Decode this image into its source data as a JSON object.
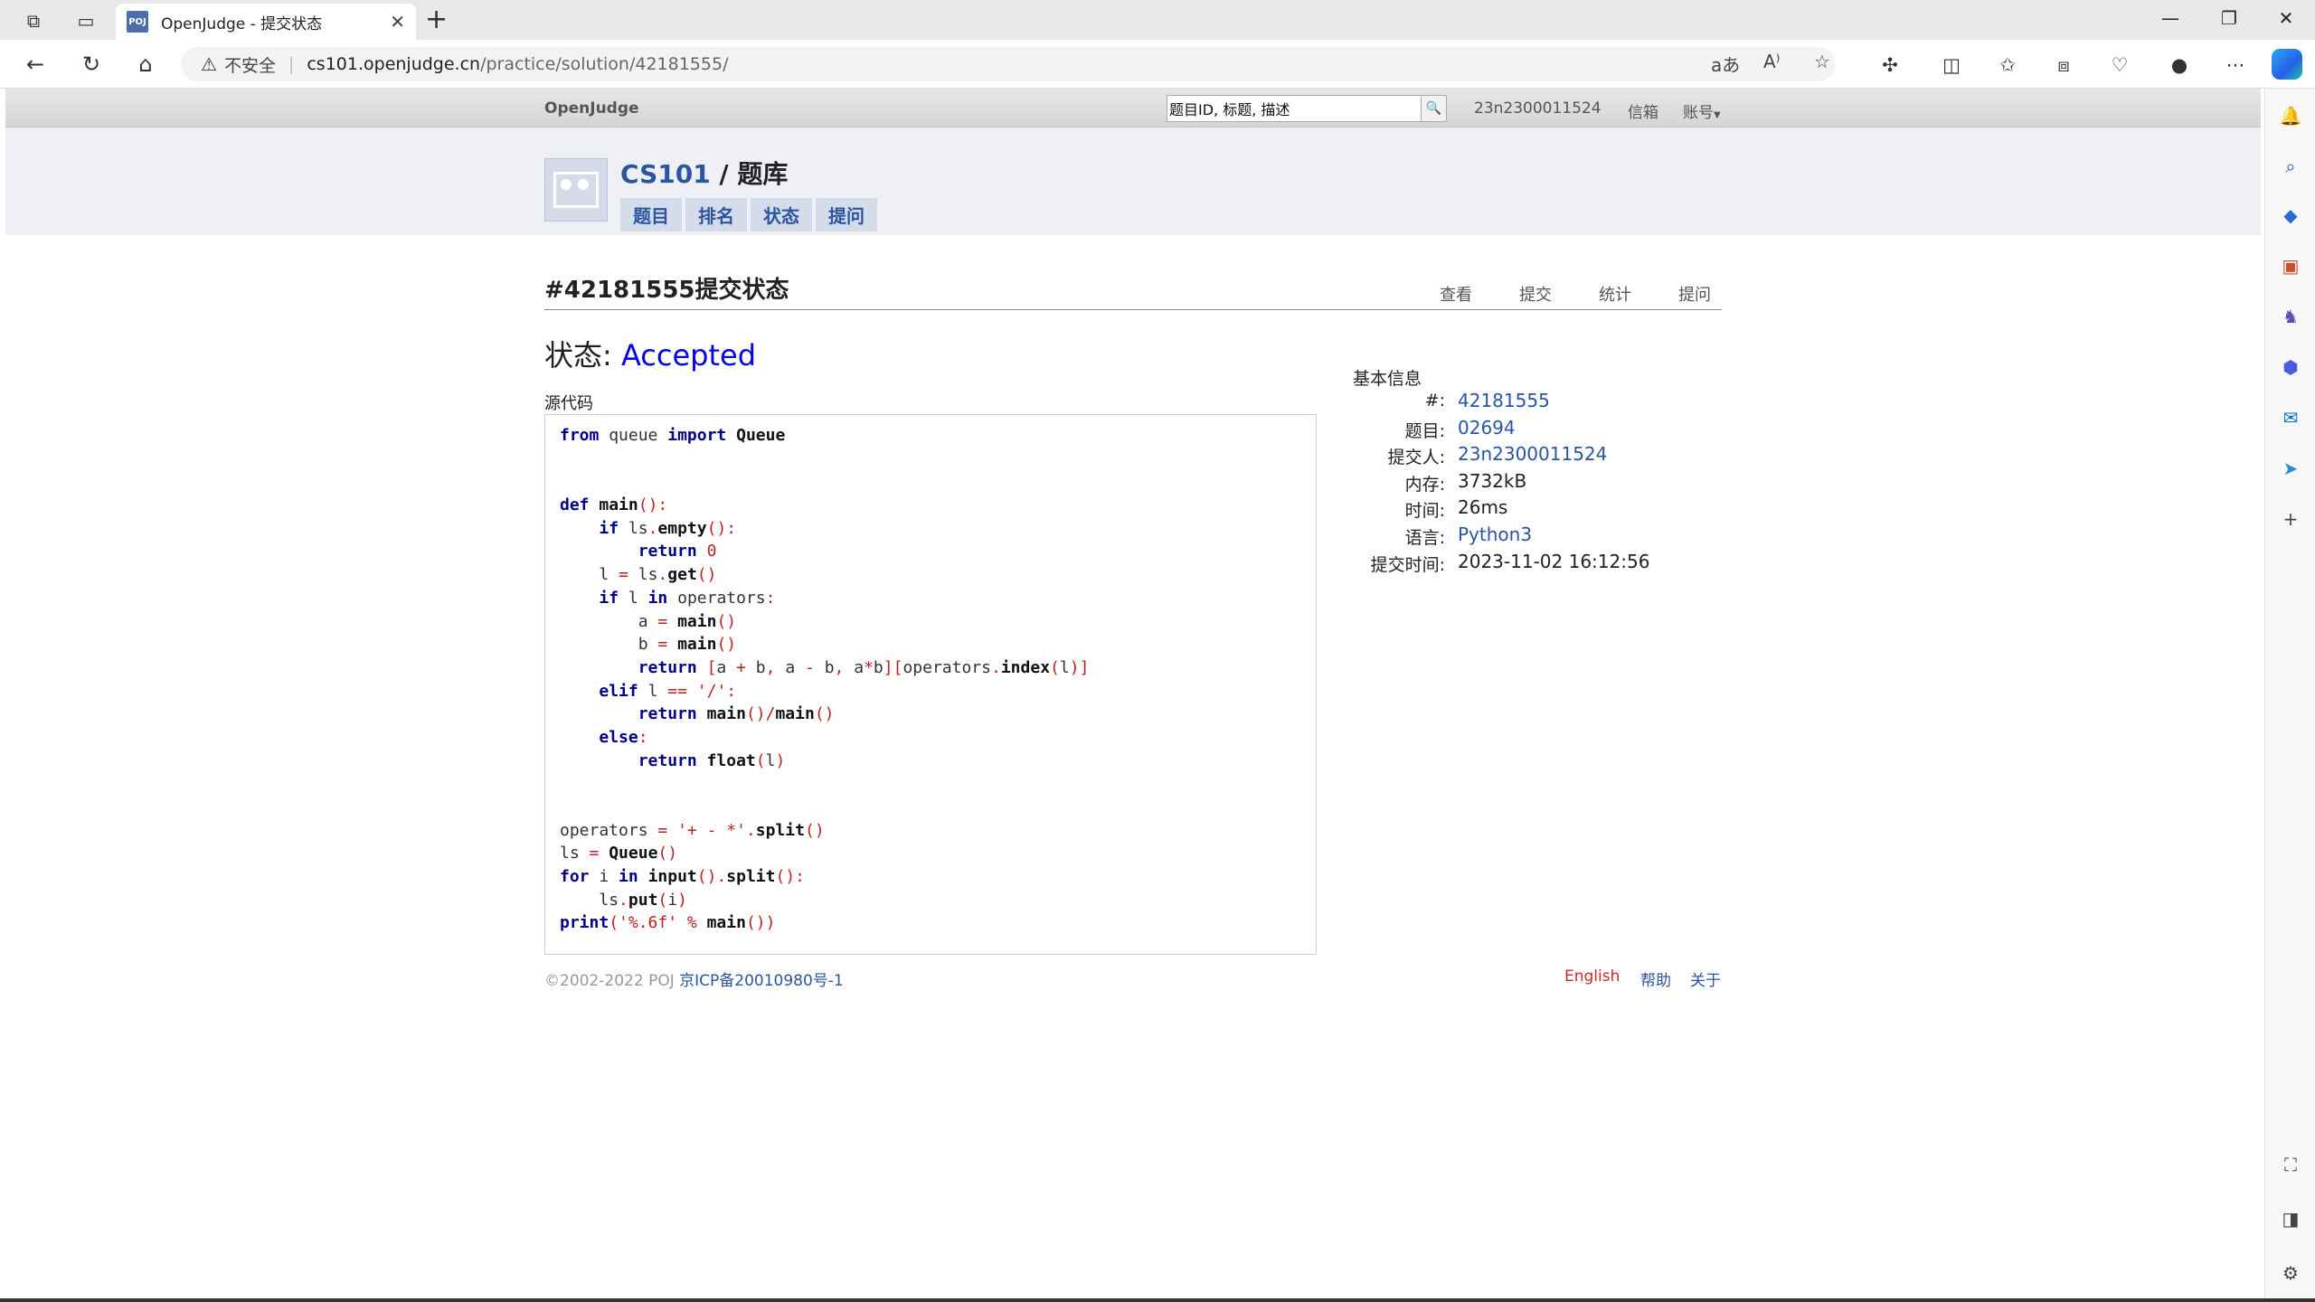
{
  "browser": {
    "tab_title": "OpenJudge - 提交状态",
    "tab_favicon_text": "POJ",
    "insecure_label": "不安全",
    "url_host": "cs101.openjudge.cn",
    "url_path": "/practice/solution/42181555/"
  },
  "topbar": {
    "brand": "OpenJudge",
    "search_placeholder": "题目ID, 标题, 描述",
    "username": "23n2300011524",
    "mail": "信箱",
    "account": "账号"
  },
  "banner": {
    "group_link": "CS101",
    "separator": " / ",
    "section": "题库",
    "tabs": [
      "题目",
      "排名",
      "状态",
      "提问"
    ]
  },
  "page": {
    "title": "#42181555提交状态",
    "actions": [
      "查看",
      "提交",
      "统计",
      "提问"
    ],
    "status_label": "状态: ",
    "status_value": "Accepted",
    "source_label": "源代码"
  },
  "info": {
    "heading": "基本信息",
    "rows": [
      {
        "label": "#:",
        "value": "42181555"
      },
      {
        "label": "题目:",
        "value": "02694"
      },
      {
        "label": "提交人:",
        "value": "23n2300011524"
      },
      {
        "label": "内存:",
        "value": "3732kB"
      },
      {
        "label": "时间:",
        "value": "26ms"
      },
      {
        "label": "语言:",
        "value": "Python3"
      },
      {
        "label": "提交时间:",
        "value": "2023-11-02 16:12:56"
      }
    ]
  },
  "code_lines": [
    "from queue import Queue",
    "",
    "",
    "def main():",
    "    if ls.empty():",
    "        return 0",
    "    l = ls.get()",
    "    if l in operators:",
    "        a = main()",
    "        b = main()",
    "        return [a + b, a - b, a*b][operators.index(l)]",
    "    elif l == '/':",
    "        return main()/main()",
    "    else:",
    "        return float(l)",
    "",
    "",
    "operators = '+ - *'.split()",
    "ls = Queue()",
    "for i in input().split():",
    "    ls.put(i)",
    "print('%.6f' % main())"
  ],
  "footer": {
    "copyright": "©2002-2022 POJ ",
    "icp": "京ICP备20010980号-1",
    "english": "English",
    "help": "帮助",
    "about": "关于"
  }
}
